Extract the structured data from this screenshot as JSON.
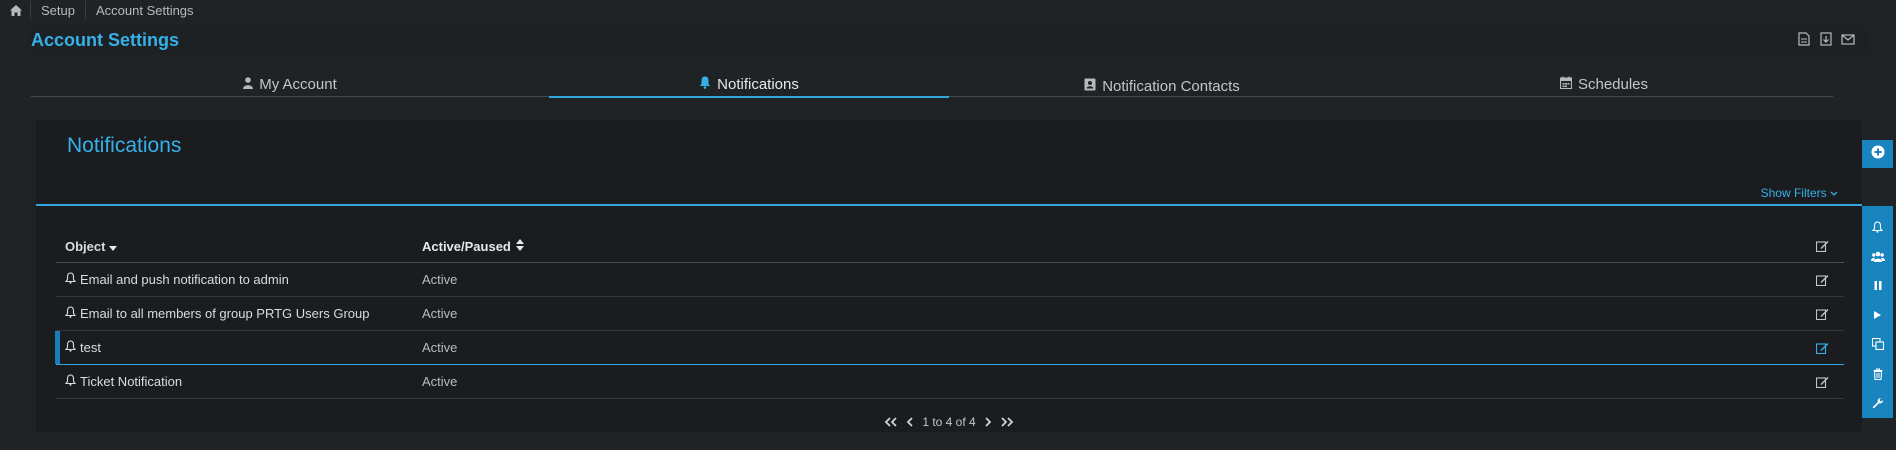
{
  "breadcrumb": {
    "home_icon": "home-icon",
    "items": [
      "Setup",
      "Account Settings"
    ]
  },
  "header": {
    "title": "Account Settings",
    "icons": [
      "document-icon",
      "export-icon",
      "mail-icon"
    ]
  },
  "tabs": [
    {
      "label": "My Account",
      "icon": "user-icon"
    },
    {
      "label": "Notifications",
      "icon": "bell-icon",
      "active": true
    },
    {
      "label": "Notification Contacts",
      "icon": "contact-card-icon"
    },
    {
      "label": "Schedules",
      "icon": "calendar-icon"
    }
  ],
  "panel": {
    "title": "Notifications",
    "show_filters": "Show Filters"
  },
  "table": {
    "columns": {
      "object": "Object",
      "status": "Active/Paused"
    },
    "rows": [
      {
        "object": "Email and push notification to admin",
        "status": "Active"
      },
      {
        "object": "Email to all members of group PRTG Users Group",
        "status": "Active"
      },
      {
        "object": "test",
        "status": "Active",
        "selected": true
      },
      {
        "object": "Ticket Notification",
        "status": "Active"
      }
    ]
  },
  "pager": {
    "text": "1 to 4 of 4"
  },
  "colors": {
    "accent": "#36b1e8",
    "rail": "#1a84bf",
    "background": "#202326",
    "panel": "#1a1c1f"
  },
  "rail": {
    "add_icon": "add-circle-icon",
    "icons": [
      "bell-icon",
      "users-icon",
      "pause-icon",
      "play-icon",
      "copy-icon",
      "trash-icon",
      "wrench-icon"
    ]
  }
}
